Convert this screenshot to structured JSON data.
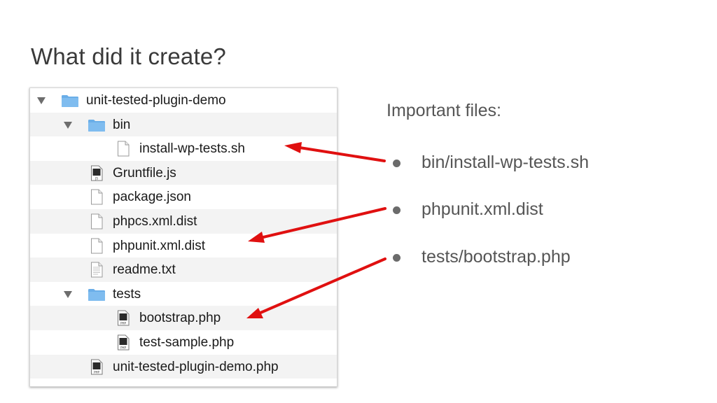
{
  "slide": {
    "title": "What did it create?"
  },
  "file_tree": {
    "rows": [
      {
        "label": "unit-tested-plugin-demo",
        "kind": "folder",
        "expanded": true,
        "icon": "folder-icon"
      },
      {
        "label": "bin",
        "kind": "folder",
        "expanded": true,
        "icon": "folder-icon"
      },
      {
        "label": "install-wp-tests.sh",
        "kind": "file",
        "icon": "blank-file-icon"
      },
      {
        "label": "Gruntfile.js",
        "kind": "file",
        "icon": "js-file-icon"
      },
      {
        "label": "package.json",
        "kind": "file",
        "icon": "blank-file-icon"
      },
      {
        "label": "phpcs.xml.dist",
        "kind": "file",
        "icon": "blank-file-icon"
      },
      {
        "label": "phpunit.xml.dist",
        "kind": "file",
        "icon": "blank-file-icon"
      },
      {
        "label": "readme.txt",
        "kind": "file",
        "icon": "text-file-icon"
      },
      {
        "label": "tests",
        "kind": "folder",
        "expanded": true,
        "icon": "folder-icon"
      },
      {
        "label": "bootstrap.php",
        "kind": "file",
        "icon": "php-file-icon"
      },
      {
        "label": "test-sample.php",
        "kind": "file",
        "icon": "php-file-icon"
      },
      {
        "label": "unit-tested-plugin-demo.php",
        "kind": "file",
        "icon": "php-file-icon"
      }
    ]
  },
  "important": {
    "heading": "Important files:",
    "items": [
      "bin/install-wp-tests.sh",
      "phpunit.xml.dist",
      "tests/bootstrap.php"
    ]
  },
  "icons": {
    "js_badge": "JS",
    "php_badge": "PHP"
  },
  "colors": {
    "folder": "#7fbcef",
    "folder_tab": "#6aaee8",
    "arrow": "#e01010",
    "row_alt": "#f3f3f3"
  }
}
